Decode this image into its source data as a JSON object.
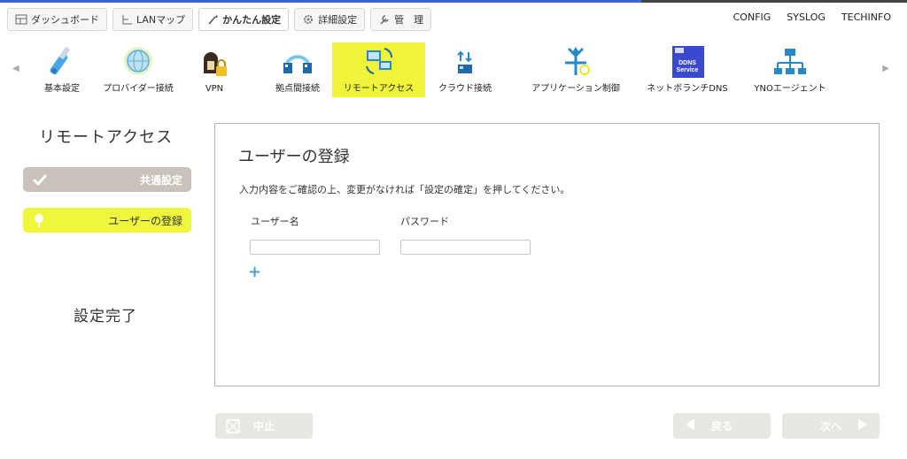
{
  "tabs": [
    {
      "label": "ダッシュボード",
      "icon": "dashboard-icon"
    },
    {
      "label": "LANマップ",
      "icon": "lan-map-icon"
    },
    {
      "label": "かんたん設定",
      "icon": "wand-icon"
    },
    {
      "label": "詳細設定",
      "icon": "gear-icon"
    },
    {
      "label": "管　理",
      "icon": "wrench-icon"
    }
  ],
  "links": [
    "CONFIG",
    "SYSLOG",
    "TECHINFO"
  ],
  "toolbar": [
    {
      "label": "基本設定",
      "icon": "basic-settings-icon"
    },
    {
      "label": "プロバイダー接続",
      "icon": "provider-globe-icon"
    },
    {
      "label": "VPN",
      "icon": "vpn-lock-icon"
    },
    {
      "label": "拠点間接続",
      "icon": "site-to-site-icon"
    },
    {
      "label": "リモートアクセス",
      "icon": "remote-access-icon"
    },
    {
      "label": "クラウド接続",
      "icon": "cloud-connect-icon"
    },
    {
      "label": "アプリケーション制御",
      "icon": "application-control-icon"
    },
    {
      "label": "ネットボランチDNS",
      "icon": "ddns-service-icon",
      "badge": "DDNS Service"
    },
    {
      "label": "YNOエージェント",
      "icon": "yno-agent-icon"
    }
  ],
  "sidebar": {
    "title": "リモートアクセス",
    "steps": [
      {
        "label": "共通設定",
        "state": "done"
      },
      {
        "label": "ユーザーの登録",
        "state": "current"
      }
    ],
    "finish": "設定完了"
  },
  "panel": {
    "title": "ユーザーの登録",
    "description": "入力内容をご確認の上、変更がなければ「設定の確定」を押してください。",
    "columns": [
      "ユーザー名",
      "パスワード"
    ],
    "username_value": "",
    "password_value": "",
    "add": "+"
  },
  "footer": {
    "cancel": "中止",
    "back": "戻る",
    "next": "次へ"
  },
  "colors": {
    "accent_highlight": "#f0f53a",
    "disabled_button": "#e9e7e4",
    "done_step": "#c8c2bb",
    "add_icon": "#4aa0d8"
  }
}
